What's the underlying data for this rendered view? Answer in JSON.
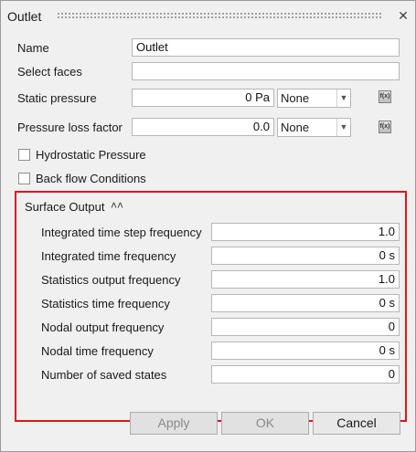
{
  "window": {
    "title": "Outlet"
  },
  "form": {
    "name": {
      "label": "Name",
      "value": "Outlet"
    },
    "select_faces": {
      "label": "Select faces",
      "value": ""
    },
    "static_pressure": {
      "label": "Static pressure",
      "value": "0 Pa",
      "unit_option": "None"
    },
    "pressure_loss": {
      "label": "Pressure loss factor",
      "value": "0.0",
      "unit_option": "None"
    },
    "hydrostatic": {
      "label": "Hydrostatic Pressure",
      "checked": false
    },
    "backflow": {
      "label": "Back flow Conditions",
      "checked": false
    }
  },
  "surface_output": {
    "title": "Surface Output",
    "rows": [
      {
        "label": "Integrated time step frequency",
        "value": "1.0"
      },
      {
        "label": "Integrated time frequency",
        "value": "0 s"
      },
      {
        "label": "Statistics output frequency",
        "value": "1.0"
      },
      {
        "label": "Statistics time frequency",
        "value": "0 s"
      },
      {
        "label": "Nodal output frequency",
        "value": "0"
      },
      {
        "label": "Nodal time frequency",
        "value": "0 s"
      },
      {
        "label": "Number of saved states",
        "value": "0"
      }
    ]
  },
  "buttons": {
    "apply": "Apply",
    "ok": "OK",
    "cancel": "Cancel"
  },
  "icons": {
    "expression": "f(x)",
    "collapse": "⌃",
    "close": "✕",
    "dropdown": "▼"
  },
  "colors": {
    "highlight_border": "#e0151f"
  }
}
